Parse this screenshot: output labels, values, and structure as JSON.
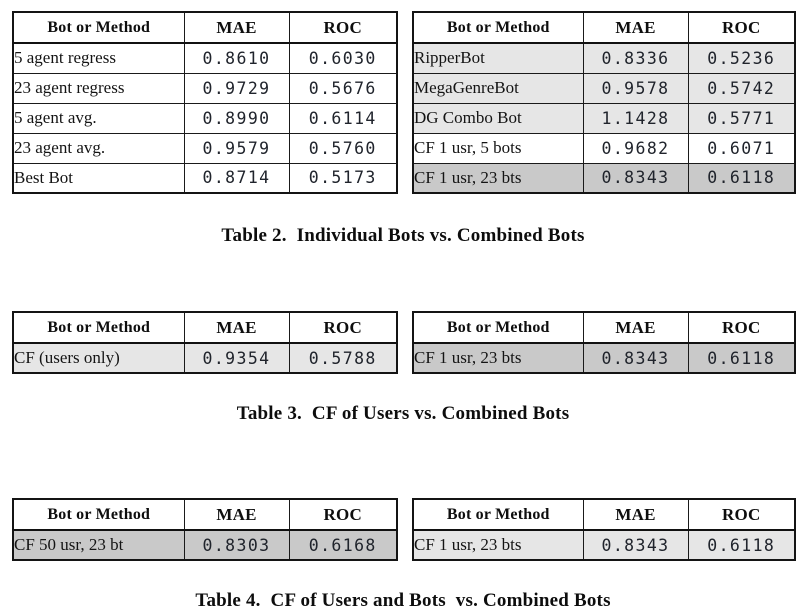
{
  "document": {
    "kind": "paper-tables-figure",
    "background_color": "#ffffff",
    "shading_colors": {
      "none": "#ffffff",
      "light": "#e6e6e6",
      "dark": "#c9c9c9"
    }
  },
  "columns": [
    "Bot or Method",
    "MAE",
    "ROC"
  ],
  "groups": [
    {
      "id": "table-2",
      "caption": "Table 2.  Individual Bots vs. Combined Bots",
      "left_table": {
        "headers": [
          "Bot or Method",
          "MAE",
          "ROC"
        ],
        "rows": [
          {
            "label": "5 agent regress",
            "mae": "0.8610",
            "roc": "0.6030",
            "shade": "none"
          },
          {
            "label": "23 agent regress",
            "mae": "0.9729",
            "roc": "0.5676",
            "shade": "none"
          },
          {
            "label": "5 agent avg.",
            "mae": "0.8990",
            "roc": "0.6114",
            "shade": "none"
          },
          {
            "label": "23 agent avg.",
            "mae": "0.9579",
            "roc": "0.5760",
            "shade": "none"
          },
          {
            "label": "Best Bot",
            "mae": "0.8714",
            "roc": "0.5173",
            "shade": "none"
          }
        ]
      },
      "right_table": {
        "headers": [
          "Bot or Method",
          "MAE",
          "ROC"
        ],
        "rows": [
          {
            "label": "RipperBot",
            "mae": "0.8336",
            "roc": "0.5236",
            "shade": "light"
          },
          {
            "label": "MegaGenreBot",
            "mae": "0.9578",
            "roc": "0.5742",
            "shade": "light"
          },
          {
            "label": "DG Combo Bot",
            "mae": "1.1428",
            "roc": "0.5771",
            "shade": "light"
          },
          {
            "label": "CF 1 usr, 5 bots",
            "mae": "0.9682",
            "roc": "0.6071",
            "shade": "none"
          },
          {
            "label": "CF 1 usr, 23 bts",
            "mae": "0.8343",
            "roc": "0.6118",
            "shade": "dark"
          }
        ]
      }
    },
    {
      "id": "table-3",
      "caption": "Table 3.  CF of Users vs. Combined Bots",
      "left_table": {
        "headers": [
          "Bot or Method",
          "MAE",
          "ROC"
        ],
        "rows": [
          {
            "label": "CF (users only)",
            "mae": "0.9354",
            "roc": "0.5788",
            "shade": "light"
          }
        ]
      },
      "right_table": {
        "headers": [
          "Bot or Method",
          "MAE",
          "ROC"
        ],
        "rows": [
          {
            "label": "CF 1 usr, 23 bts",
            "mae": "0.8343",
            "roc": "0.6118",
            "shade": "dark"
          }
        ]
      }
    },
    {
      "id": "table-4",
      "caption": "Table 4.  CF of Users and Bots  vs. Combined Bots",
      "left_table": {
        "headers": [
          "Bot or Method",
          "MAE",
          "ROC"
        ],
        "rows": [
          {
            "label": "CF 50 usr, 23 bt",
            "mae": "0.8303",
            "roc": "0.6168",
            "shade": "dark"
          }
        ]
      },
      "right_table": {
        "headers": [
          "Bot or Method",
          "MAE",
          "ROC"
        ],
        "rows": [
          {
            "label": "CF 1 usr, 23 bts",
            "mae": "0.8343",
            "roc": "0.6118",
            "shade": "light"
          }
        ]
      }
    }
  ]
}
